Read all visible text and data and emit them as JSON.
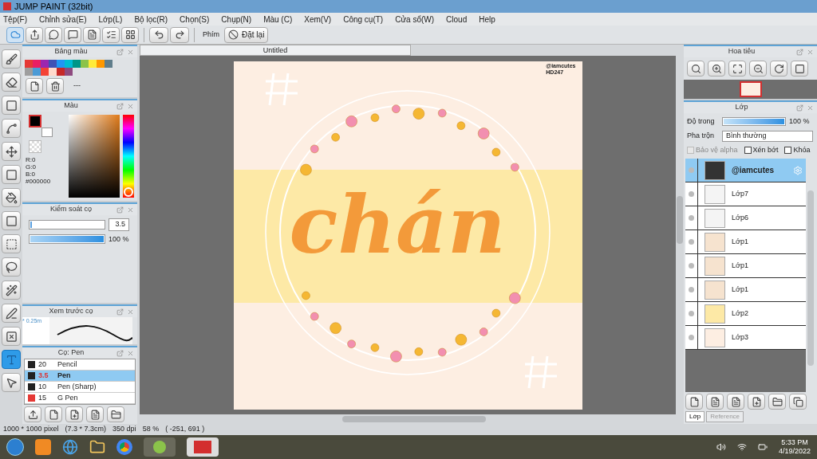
{
  "window": {
    "title": "JUMP PAINT (32bit)"
  },
  "menu": [
    "Tệp(F)",
    "Chỉnh sửa(E)",
    "Lớp(L)",
    "Bộ lọc(R)",
    "Chọn(S)",
    "Chụp(N)",
    "Màu (C)",
    "Xem(V)",
    "Công cụ(T)",
    "Cửa sổ(W)",
    "Cloud",
    "Help"
  ],
  "toolbar": {
    "key_label": "Phím",
    "reset_label": "Đặt lại"
  },
  "tools": [
    {
      "selected": false
    },
    {
      "selected": false
    },
    {
      "selected": false
    },
    {
      "selected": false
    },
    {
      "selected": false
    },
    {
      "selected": false
    },
    {
      "selected": false
    },
    {
      "selected": false
    },
    {
      "selected": false
    },
    {
      "selected": false
    },
    {
      "selected": false
    },
    {
      "selected": false
    },
    {
      "selected": false
    },
    {
      "selected": true
    },
    {
      "selected": false
    }
  ],
  "palette": {
    "title": "Bảng màu",
    "swatches": [
      {
        "color": "#e53935"
      },
      {
        "color": "#e91e63"
      },
      {
        "color": "#9c27b0"
      },
      {
        "color": "#3f51b5"
      },
      {
        "color": "#2196f3"
      },
      {
        "color": "#00bcd4"
      },
      {
        "color": "#009688"
      },
      {
        "color": "#8bc34a"
      },
      {
        "color": "#ffeb3b"
      },
      {
        "color": "#ff9800"
      },
      {
        "color": "#607d8b"
      },
      {
        "color": "#9e9e9e"
      },
      {
        "color": "#4c9bd6"
      },
      {
        "color": "#f44336"
      },
      {
        "color": "#ffd9cc"
      },
      {
        "color": "#c62828"
      },
      {
        "color": "#8e4a7f"
      }
    ],
    "name": "---"
  },
  "color_panel": {
    "title": "Màu",
    "r": "R:0",
    "g": "G:0",
    "b": "B:0",
    "hex": "#000000"
  },
  "brush_control": {
    "title": "Kiểm soát cọ",
    "size_slider": {
      "level": 0.02
    },
    "size": "3.5",
    "opacity_slider": {
      "level": 1
    },
    "opacity": "100 %"
  },
  "brush_preview": {
    "title": "Xem trước cọ",
    "size": "* 0.25m"
  },
  "brushes": {
    "title": "Cọ: Pen",
    "items": [
      {
        "size": "20",
        "name": "Pencil",
        "color": "#222222",
        "selected": false
      },
      {
        "size": "3.5",
        "name": "Pen",
        "color": "#222222",
        "selected": true
      },
      {
        "size": "10",
        "name": "Pen (Sharp)",
        "color": "#222222",
        "selected": false
      },
      {
        "size": "15",
        "name": "G Pen",
        "color": "#e53935",
        "selected": false
      }
    ]
  },
  "canvas": {
    "tab": "Untitled",
    "lettering": "chán",
    "signature": [
      "@iamcutes",
      "HD247"
    ]
  },
  "navigator": {
    "title": "Hoa tiêu"
  },
  "layers": {
    "title": "Lớp",
    "opacity_label": "Độ trong",
    "opacity_slider": {
      "level": 1
    },
    "opacity": "100 %",
    "blend_label": "Pha trộn",
    "blend": "Bình thường",
    "options": [
      {
        "label": "Bảo vệ alpha",
        "checked": false,
        "disabled": true
      },
      {
        "label": "Xén bớt",
        "checked": false,
        "disabled": false
      },
      {
        "label": "Khóa",
        "checked": false,
        "disabled": false
      }
    ],
    "items": [
      {
        "name": "@iamcutes",
        "kind": "text",
        "selected": true
      },
      {
        "name": "Lớp7",
        "kind": "empty",
        "selected": false
      },
      {
        "name": "Lớp6",
        "kind": "empty",
        "selected": false
      },
      {
        "name": "Lớp1",
        "kind": "lettering",
        "selected": false
      },
      {
        "name": "Lớp1",
        "kind": "lettering",
        "selected": false
      },
      {
        "name": "Lớp1",
        "kind": "lettering",
        "selected": false
      },
      {
        "name": "Lớp2",
        "kind": "band",
        "selected": false
      },
      {
        "name": "Lớp3",
        "kind": "fill",
        "selected": false
      }
    ],
    "tabs": [
      {
        "label": "Lớp",
        "selected": true
      },
      {
        "label": "Reference",
        "selected": false
      }
    ]
  },
  "status_bar": [
    "1000 * 1000 pixel",
    "(7.3 * 7.3cm)",
    "350 dpi",
    "58 %",
    "( -251, 691 )"
  ],
  "taskbar": {
    "time": "5:33 PM",
    "date": "4/19/2022"
  }
}
